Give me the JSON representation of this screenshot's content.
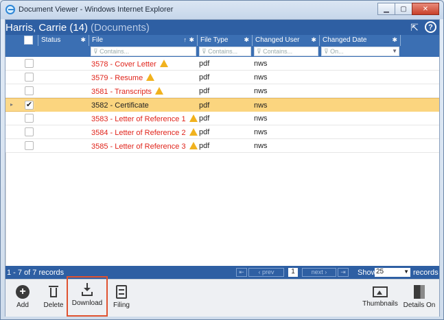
{
  "window": {
    "title": "Document Viewer - Windows Internet Explorer",
    "controls": [
      "minimize",
      "maximize",
      "close"
    ]
  },
  "header": {
    "name": "Harris, Carrie (14)",
    "section": "(Documents)",
    "icons": [
      "expand-icon",
      "help-icon"
    ]
  },
  "columns": [
    {
      "label": "",
      "filter": ""
    },
    {
      "label": "Status",
      "filter": ""
    },
    {
      "label": "File",
      "filter": "Contains...",
      "sorted": "ascending"
    },
    {
      "label": "File Type",
      "filter": "Contains..."
    },
    {
      "label": "Changed User",
      "filter": "Contains..."
    },
    {
      "label": "Changed Date",
      "filter": "On..."
    }
  ],
  "rows": [
    {
      "file": "3578 - Cover Letter",
      "type": "pdf",
      "user": "nws",
      "warning": true,
      "checked": false,
      "selected": false
    },
    {
      "file": "3579 - Resume",
      "type": "pdf",
      "user": "nws",
      "warning": true,
      "checked": false,
      "selected": false
    },
    {
      "file": "3581 - Transcripts",
      "type": "pdf",
      "user": "nws",
      "warning": true,
      "checked": false,
      "selected": false
    },
    {
      "file": "3582 - Certificate",
      "type": "pdf",
      "user": "nws",
      "warning": false,
      "checked": true,
      "selected": true
    },
    {
      "file": "3583 - Letter of Reference 1",
      "type": "pdf",
      "user": "nws",
      "warning": true,
      "checked": false,
      "selected": false
    },
    {
      "file": "3584 - Letter of Reference 2",
      "type": "pdf",
      "user": "nws",
      "warning": true,
      "checked": false,
      "selected": false
    },
    {
      "file": "3585 - Letter of Reference 3",
      "type": "pdf",
      "user": "nws",
      "warning": true,
      "checked": false,
      "selected": false
    }
  ],
  "pager": {
    "records_text": "1 - 7 of 7 records",
    "prev": "prev",
    "next": "next",
    "page": "1",
    "show_label": "Show",
    "show_value": "25",
    "records_label": "records"
  },
  "toolbar": {
    "add": "Add",
    "delete": "Delete",
    "download": "Download",
    "filing": "Filing",
    "thumbnails": "Thumbnails",
    "details_on": "Details On"
  },
  "colors": {
    "header_blue": "#2e5fa3",
    "selected_row": "#fcd98b",
    "warning_text": "#e0241b",
    "warning_icon": "#f1b21e",
    "highlight_border": "#e0522f"
  }
}
